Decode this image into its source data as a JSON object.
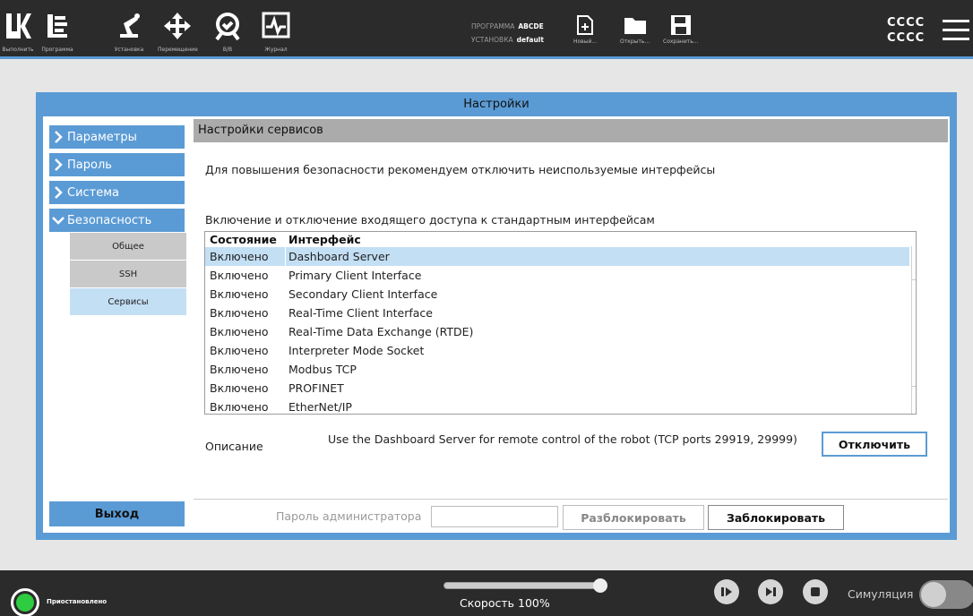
{
  "toolbar": {
    "items": [
      {
        "label": "Выполнить",
        "icon": "ur-logo-icon"
      },
      {
        "label": "Программа",
        "icon": "program-icon"
      },
      {
        "label": "Установка",
        "icon": "robot-arm-icon"
      },
      {
        "label": "Перемещение",
        "icon": "move-arrows-icon"
      },
      {
        "label": "В/В",
        "icon": "io-icon"
      },
      {
        "label": "Журнал",
        "icon": "log-icon"
      }
    ],
    "program_label": "ПРОГРАММА",
    "program_value": "ABCDE",
    "install_label": "УСТАНОВКА",
    "install_value": "default",
    "new_label": "Новый...",
    "open_label": "Открыть...",
    "save_label": "Сохранить...",
    "user_line1": "CCCC",
    "user_line2": "CCCC"
  },
  "dialog": {
    "title": "Настройки",
    "nav": [
      {
        "label": "Параметры",
        "expanded": false
      },
      {
        "label": "Пароль",
        "expanded": false
      },
      {
        "label": "Система",
        "expanded": false
      },
      {
        "label": "Безопасность",
        "expanded": true
      }
    ],
    "sub_nav": [
      {
        "label": "Общее",
        "active": false
      },
      {
        "label": "SSH",
        "active": false
      },
      {
        "label": "Сервисы",
        "active": true
      }
    ],
    "exit_label": "Выход"
  },
  "services": {
    "header": "Настройки сервисов",
    "recommendation": "Для повышения безопасности рекомендуем отключить неиспользуемые интерфейсы",
    "table_caption": "Включение и отключение входящего доступа к стандартным интерфейсам",
    "col_state": "Состояние",
    "col_interface": "Интерфейс",
    "rows": [
      {
        "state": "Включено",
        "interface": "Dashboard Server",
        "selected": true
      },
      {
        "state": "Включено",
        "interface": "Primary Client Interface"
      },
      {
        "state": "Включено",
        "interface": "Secondary Client Interface"
      },
      {
        "state": "Включено",
        "interface": "Real-Time Client Interface"
      },
      {
        "state": "Включено",
        "interface": "Real-Time Data Exchange (RTDE)"
      },
      {
        "state": "Включено",
        "interface": "Interpreter Mode Socket"
      },
      {
        "state": "Включено",
        "interface": "Modbus TCP"
      },
      {
        "state": "Включено",
        "interface": "PROFINET"
      },
      {
        "state": "Включено",
        "interface": "EtherNet/IP"
      }
    ],
    "description_label": "Описание",
    "description": "Use the Dashboard Server for remote control of the robot (TCP ports 29919, 29999)",
    "disable_label": "Отключить",
    "admin_password_label": "Пароль администратора",
    "admin_password_value": "",
    "unlock_label": "Разблокировать",
    "lock_label": "Заблокировать"
  },
  "footer": {
    "status": "Приостановлено",
    "speed_text": "Скорость 100%",
    "speed_percent": 100,
    "simulation_label": "Симуляция",
    "simulation_on": false
  },
  "colors": {
    "accent": "#5b9bd5",
    "bar": "#2b2b2b",
    "selected": "#c3dff4",
    "status_green": "#2ecc40"
  }
}
